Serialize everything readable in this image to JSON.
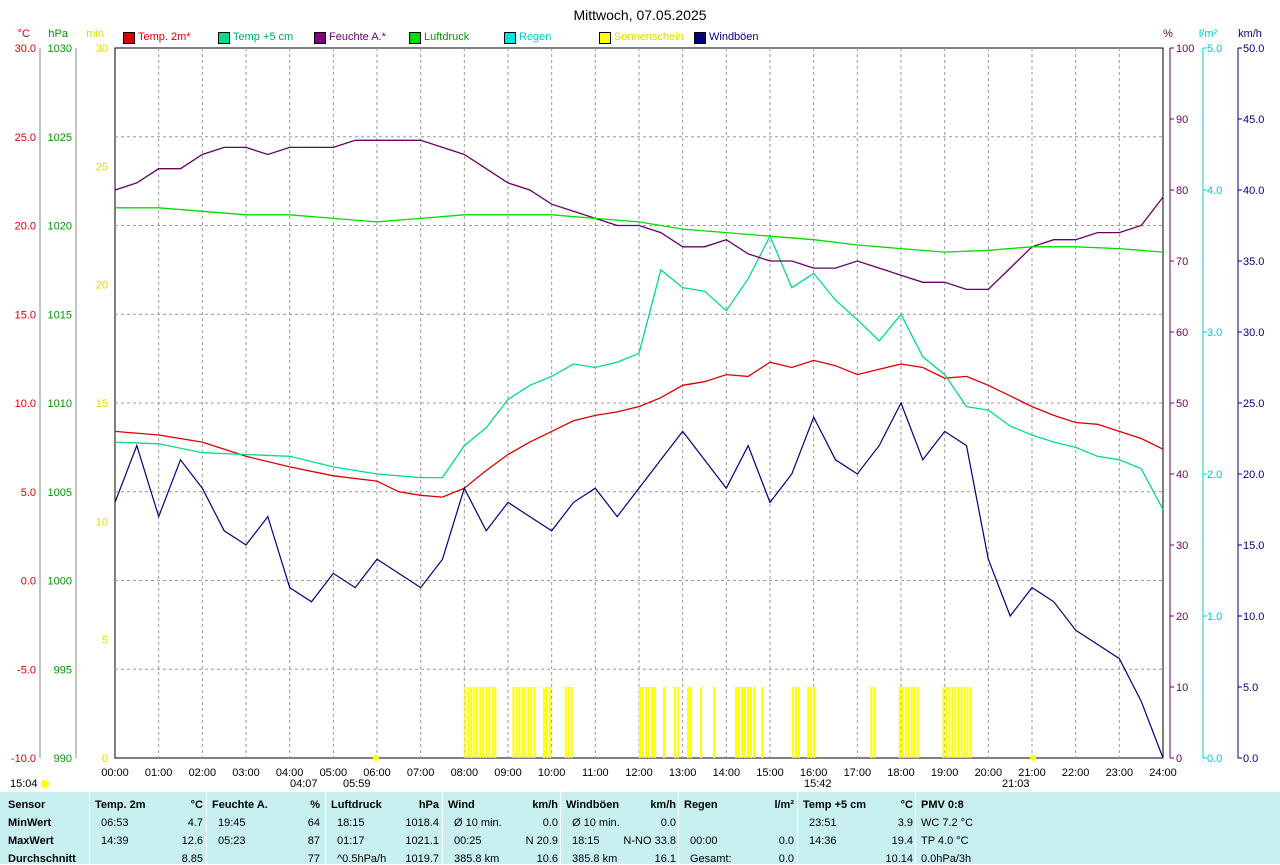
{
  "title": "Mittwoch, 07.05.2025",
  "colors": {
    "temp2m": "#dd0000",
    "temp5cm": "#00dd88",
    "feuchte": "#660066",
    "luftdruck": "#00dd00",
    "regen": "#00e5e5",
    "sonne": "#ffff00",
    "wind": "#000080",
    "grid": "#999999",
    "stats_bg": "#c8f0f0"
  },
  "legend": [
    {
      "label": "Temp. 2m*",
      "color": "#dd0000",
      "text_color": "#dd0000"
    },
    {
      "label": "Temp +5 cm",
      "color": "#00dd88",
      "text_color": "#00aa66"
    },
    {
      "label": "Feuchte A.*",
      "color": "#800080",
      "text_color": "#660066"
    },
    {
      "label": "Luftdruck",
      "color": "#00dd00",
      "text_color": "#009900"
    },
    {
      "label": "Regen",
      "color": "#00e5e5",
      "text_color": "#00cccc"
    },
    {
      "label": "Sonnenschein",
      "color": "#ffff00",
      "text_color": "#dddd00"
    },
    {
      "label": "Windböen",
      "color": "#000080",
      "text_color": "#000080"
    }
  ],
  "axes": {
    "unit_temp": "°C",
    "unit_hpa": "hPa",
    "unit_min": "min",
    "unit_pct": "%",
    "unit_rain": "l/m²",
    "unit_kmh": "km/h",
    "temp_ticks": [
      "30.0",
      "25.0",
      "20.0",
      "15.0",
      "10.0",
      "5.0",
      "0.0",
      "-5.0",
      "-10.0"
    ],
    "hpa_ticks": [
      "1030",
      "1025",
      "1020",
      "1015",
      "1010",
      "1005",
      "1000",
      "995",
      "990"
    ],
    "min_ticks": [
      "30",
      "25",
      "20",
      "15",
      "10",
      "5",
      "0"
    ],
    "pct_ticks": [
      "100",
      "90",
      "80",
      "70",
      "60",
      "50",
      "40",
      "30",
      "20",
      "10",
      "0"
    ],
    "rain_ticks": [
      "5.0",
      "4.0",
      "3.0",
      "2.0",
      "1.0",
      "0.0"
    ],
    "kmh_ticks": [
      "50.0",
      "45.0",
      "40.0",
      "35.0",
      "30.0",
      "25.0",
      "20.0",
      "15.0",
      "10.0",
      "5.0",
      "0.0"
    ],
    "time_ticks": [
      "00:00",
      "01:00",
      "02:00",
      "03:00",
      "04:00",
      "05:00",
      "06:00",
      "07:00",
      "08:00",
      "09:00",
      "10:00",
      "11:00",
      "12:00",
      "13:00",
      "14:00",
      "15:00",
      "16:00",
      "17:00",
      "18:00",
      "19:00",
      "20:00",
      "21:00",
      "22:00",
      "23:00",
      "24:00"
    ]
  },
  "markers": {
    "sunrise": "15:04",
    "moonrise": "04:07",
    "sunrise2": "05:59",
    "moonset": "15:42",
    "sunset": "21:03"
  },
  "chart_data": {
    "type": "line",
    "x_unit": "hour of day",
    "xlim": [
      0,
      24
    ],
    "series": [
      {
        "name": "Temp. 2m*",
        "unit": "°C",
        "ylim": [
          -10,
          30
        ],
        "x": [
          0,
          1,
          2,
          3,
          4,
          5,
          6,
          6.5,
          7,
          7.5,
          8,
          8.5,
          9,
          9.5,
          10,
          10.5,
          11,
          11.5,
          12,
          12.5,
          13,
          13.5,
          14,
          14.5,
          15,
          15.5,
          16,
          16.5,
          17,
          17.5,
          18,
          18.5,
          19,
          19.5,
          20,
          20.5,
          21,
          21.5,
          22,
          22.5,
          23,
          23.5,
          24
        ],
        "y": [
          8.4,
          8.2,
          7.8,
          7.0,
          6.4,
          5.9,
          5.6,
          5.0,
          4.8,
          4.7,
          5.2,
          6.2,
          7.1,
          7.8,
          8.4,
          9.0,
          9.3,
          9.5,
          9.8,
          10.3,
          11.0,
          11.2,
          11.6,
          11.5,
          12.3,
          12.0,
          12.4,
          12.1,
          11.6,
          11.9,
          12.2,
          12.0,
          11.4,
          11.5,
          11.0,
          10.4,
          9.8,
          9.3,
          8.9,
          8.8,
          8.4,
          8.0,
          7.4
        ]
      },
      {
        "name": "Temp +5 cm",
        "unit": "°C",
        "ylim": [
          -10,
          30
        ],
        "x": [
          0,
          1,
          2,
          3,
          4,
          5,
          6,
          7,
          7.5,
          8,
          8.5,
          9,
          9.5,
          10,
          10.5,
          11,
          11.5,
          12,
          12.5,
          13,
          13.5,
          14,
          14.5,
          15,
          15.5,
          16,
          16.5,
          17,
          17.5,
          18,
          18.5,
          19,
          19.5,
          20,
          20.5,
          21,
          21.5,
          22,
          22.5,
          23,
          23.5,
          24
        ],
        "y": [
          7.8,
          7.7,
          7.2,
          7.1,
          7.0,
          6.4,
          6.0,
          5.8,
          5.8,
          7.6,
          8.6,
          10.2,
          11.0,
          11.5,
          12.2,
          12.0,
          12.3,
          12.8,
          17.5,
          16.5,
          16.3,
          15.2,
          17.0,
          19.4,
          16.5,
          17.3,
          15.8,
          14.7,
          13.5,
          15.0,
          12.6,
          11.6,
          9.8,
          9.6,
          8.7,
          8.2,
          7.8,
          7.5,
          7.0,
          6.8,
          6.3,
          4.0
        ]
      },
      {
        "name": "Feuchte A.*",
        "unit": "%",
        "ylim": [
          0,
          100
        ],
        "x": [
          0,
          0.5,
          1,
          1.5,
          2,
          2.5,
          3,
          3.5,
          4,
          4.5,
          5,
          5.5,
          6,
          6.5,
          7,
          7.5,
          8,
          8.5,
          9,
          9.5,
          10,
          10.5,
          11,
          11.5,
          12,
          12.5,
          13,
          13.5,
          14,
          14.5,
          15,
          15.5,
          16,
          16.5,
          17,
          17.5,
          18,
          18.5,
          19,
          19.5,
          20,
          20.5,
          21,
          21.5,
          22,
          22.5,
          23,
          23.5,
          24
        ],
        "y": [
          80,
          81,
          83,
          83,
          85,
          86,
          86,
          85,
          86,
          86,
          86,
          87,
          87,
          87,
          87,
          86,
          85,
          83,
          81,
          80,
          78,
          77,
          76,
          75,
          75,
          74,
          72,
          72,
          73,
          71,
          70,
          70,
          69,
          69,
          70,
          69,
          68,
          67,
          67,
          66,
          66,
          69,
          72,
          73,
          73,
          74,
          74,
          75,
          79
        ]
      },
      {
        "name": "Luftdruck",
        "unit": "hPa",
        "ylim": [
          990,
          1030
        ],
        "x": [
          0,
          1,
          2,
          3,
          4,
          5,
          6,
          7,
          8,
          9,
          10,
          11,
          12,
          13,
          14,
          15,
          16,
          17,
          18,
          19,
          20,
          21,
          22,
          23,
          24
        ],
        "y": [
          1021.0,
          1021.0,
          1020.8,
          1020.6,
          1020.6,
          1020.4,
          1020.2,
          1020.4,
          1020.6,
          1020.6,
          1020.6,
          1020.4,
          1020.2,
          1019.8,
          1019.6,
          1019.4,
          1019.2,
          1018.9,
          1018.7,
          1018.5,
          1018.6,
          1018.8,
          1018.8,
          1018.7,
          1018.5
        ]
      },
      {
        "name": "Windböen",
        "unit": "km/h",
        "ylim": [
          0,
          50
        ],
        "x": [
          0,
          0.5,
          1,
          1.5,
          2,
          2.5,
          3,
          3.5,
          4,
          4.5,
          5,
          5.5,
          6,
          6.5,
          7,
          7.5,
          8,
          8.5,
          9,
          9.5,
          10,
          10.5,
          11,
          11.5,
          12,
          12.5,
          13,
          13.5,
          14,
          14.5,
          15,
          15.5,
          16,
          16.5,
          17,
          17.5,
          18,
          18.5,
          19,
          19.5,
          20,
          20.5,
          21,
          21.5,
          22,
          22.5,
          23,
          23.5,
          24
        ],
        "y": [
          18,
          22,
          17,
          21,
          19,
          16,
          15,
          17,
          12,
          11,
          13,
          12,
          14,
          13,
          12,
          14,
          19,
          16,
          18,
          17,
          16,
          18,
          19,
          17,
          19,
          21,
          23,
          21,
          19,
          22,
          18,
          20,
          24,
          21,
          20,
          22,
          25,
          21,
          23,
          22,
          14,
          10,
          12,
          11,
          9,
          8,
          7,
          4,
          0
        ]
      }
    ],
    "sunshine_minutes": {
      "name": "Sonnenschein",
      "periods": [
        [
          8.0,
          8.75
        ],
        [
          9.1,
          9.6
        ],
        [
          9.8,
          9.95
        ],
        [
          10.3,
          10.45
        ],
        [
          12.0,
          12.4
        ],
        [
          12.55,
          12.6
        ],
        [
          12.8,
          12.9
        ],
        [
          13.1,
          13.2
        ],
        [
          13.4,
          13.45
        ],
        [
          13.7,
          13.75
        ],
        [
          14.2,
          14.65
        ],
        [
          14.8,
          14.85
        ],
        [
          15.5,
          15.65
        ],
        [
          15.85,
          16.0
        ],
        [
          17.3,
          17.4
        ],
        [
          17.95,
          18.4
        ],
        [
          18.95,
          19.6
        ]
      ]
    }
  },
  "stats": {
    "headers": [
      {
        "label": "Sensor",
        "unit": ""
      },
      {
        "label": "Temp. 2m",
        "unit": "°C"
      },
      {
        "label": "Feuchte A.",
        "unit": "%"
      },
      {
        "label": "Luftdruck",
        "unit": "hPa"
      },
      {
        "label": "Wind",
        "unit": "km/h"
      },
      {
        "label": "Windböen",
        "unit": "km/h"
      },
      {
        "label": "Regen",
        "unit": "l/m²"
      },
      {
        "label": "Temp +5 cm",
        "unit": "°C"
      },
      {
        "label": "PMV 0:8",
        "unit": ""
      }
    ],
    "rows": [
      {
        "label": "MinWert",
        "cells": [
          [
            "06:53",
            "4.7"
          ],
          [
            "19:45",
            "64"
          ],
          [
            "18:15",
            "1018.4"
          ],
          [
            "Ø 10 min.",
            "0.0"
          ],
          [
            "Ø 10 min.",
            "0.0"
          ],
          [
            "",
            ""
          ],
          [
            "23:51",
            "3.9"
          ],
          [
            "WC 7.2 °C",
            ""
          ]
        ]
      },
      {
        "label": "MaxWert",
        "cells": [
          [
            "14:39",
            "12.6"
          ],
          [
            "05:23",
            "87"
          ],
          [
            "01:17",
            "1021.1"
          ],
          [
            "00:25",
            "N 20.9"
          ],
          [
            "18:15",
            "N-NO 33.8"
          ],
          [
            "00:00",
            "0.0"
          ],
          [
            "14:36",
            "19.4"
          ],
          [
            "TP 4.0 °C",
            ""
          ]
        ]
      },
      {
        "label": "Durchschnitt",
        "cells": [
          [
            "",
            "8.85"
          ],
          [
            "",
            "77"
          ],
          [
            "^0.5hPa/h",
            "1019.7"
          ],
          [
            "385.8 km",
            "10.6"
          ],
          [
            "385.8 km",
            "16.1"
          ],
          [
            "Gesamt:",
            "0.0"
          ],
          [
            "",
            "10.14"
          ],
          [
            "0.0hPa/3h",
            ""
          ]
        ]
      }
    ]
  }
}
